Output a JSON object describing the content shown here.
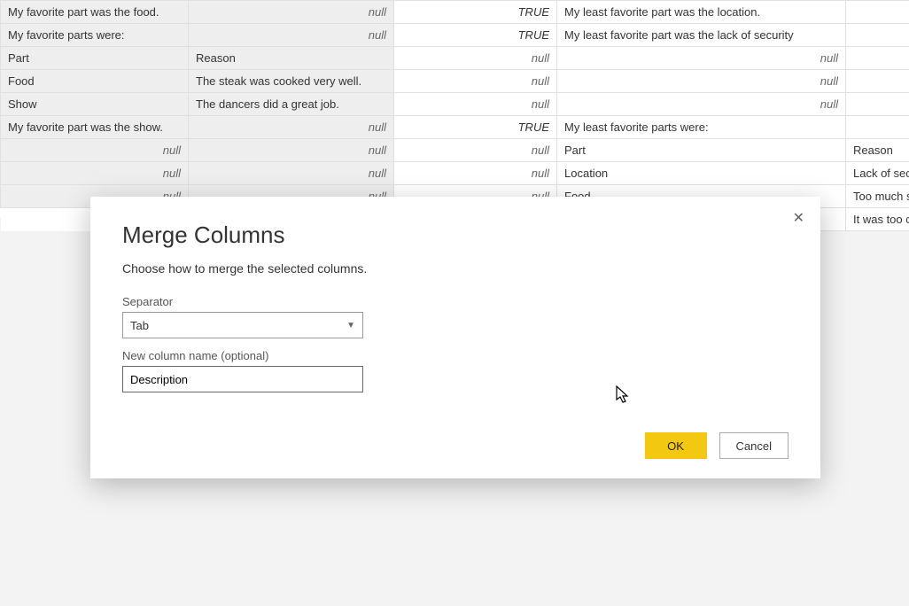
{
  "null_label": "null",
  "true_label": "TRUE",
  "table": {
    "rows": [
      {
        "c1": "My favorite part was the food.",
        "c1n": false,
        "c2n": true,
        "c3t": true,
        "c4": "My least favorite part was the location.",
        "c4n": false,
        "c5": "",
        "c5n": false
      },
      {
        "c1": "My favorite parts were:",
        "c1n": false,
        "c2n": true,
        "c3t": true,
        "c4": "My least favorite part was  the lack of security",
        "c4n": false,
        "c5": "",
        "c5n": false
      },
      {
        "c1": "Part",
        "c1n": false,
        "c2v": "Reason",
        "c2n": false,
        "c3n": true,
        "c4n": true,
        "c5n": true
      },
      {
        "c1": "Food",
        "c1n": false,
        "c2v": "The steak was cooked very well.",
        "c2n": false,
        "c3n": true,
        "c4n": true,
        "c5n": true
      },
      {
        "c1": "Show",
        "c1n": false,
        "c2v": "The dancers did a great job.",
        "c2n": false,
        "c3n": true,
        "c4n": true,
        "c5n": true
      },
      {
        "c1": "My favorite part was the show.",
        "c1n": false,
        "c2n": true,
        "c3t": true,
        "c4": "My least favorite parts were:",
        "c4n": false,
        "c5": "",
        "c5n": false
      },
      {
        "c1n": true,
        "c2n": true,
        "c3n": true,
        "c4": "Part",
        "c4n": false,
        "c5": "Reason",
        "c5n": false
      },
      {
        "c1n": true,
        "c2n": true,
        "c3n": true,
        "c4": "Location",
        "c4n": false,
        "c5": "Lack of security",
        "c5n": false
      },
      {
        "c1n": true,
        "c2n": true,
        "c3n": true,
        "c4": "Food",
        "c4n": false,
        "c5": "Too much salt",
        "c5n": false
      },
      {
        "hidden12": true,
        "c4": "",
        "c4n": false,
        "c5": "It was too cold",
        "c5n": false
      }
    ]
  },
  "dialog": {
    "title": "Merge Columns",
    "subtitle": "Choose how to merge the selected columns.",
    "separator_label": "Separator",
    "separator_value": "Tab",
    "newcol_label": "New column name (optional)",
    "newcol_value": "Description",
    "ok": "OK",
    "cancel": "Cancel"
  }
}
